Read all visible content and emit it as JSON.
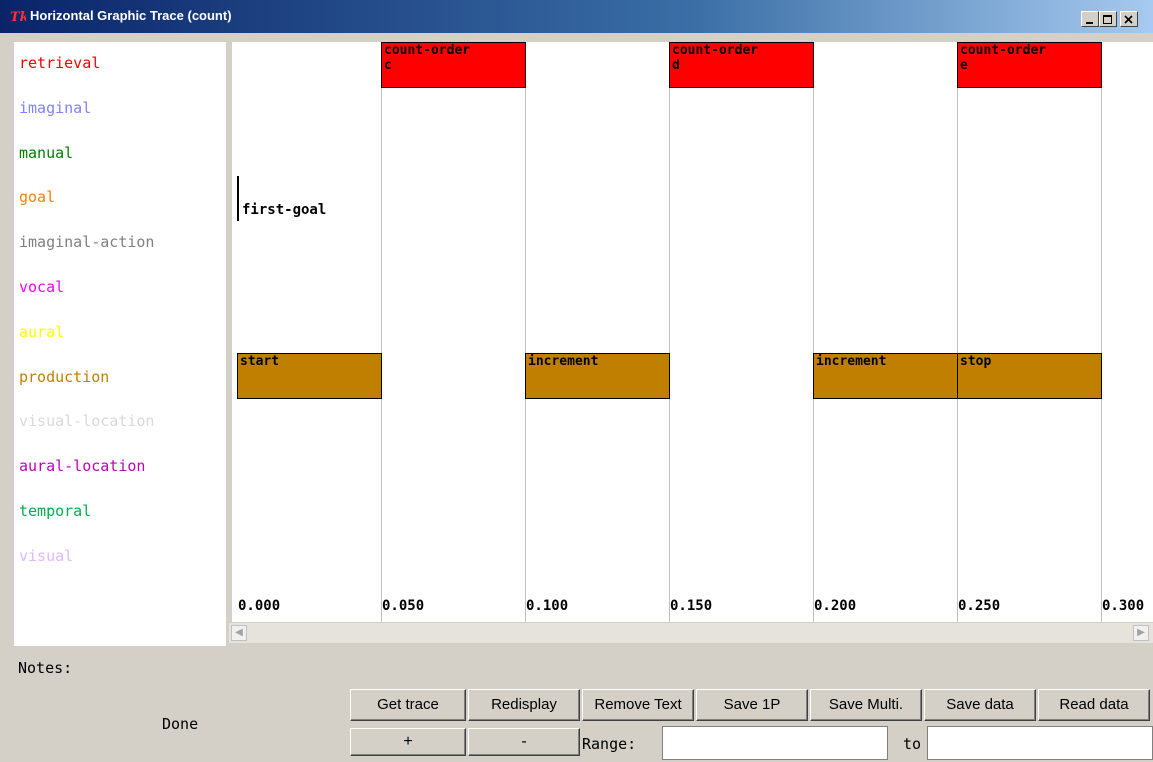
{
  "window": {
    "title": "Horizontal Graphic Trace (count)"
  },
  "modules": [
    {
      "label": "retrieval",
      "color": "#ff0000"
    },
    {
      "label": "imaginal",
      "color": "#8080ff"
    },
    {
      "label": "manual",
      "color": "#008000"
    },
    {
      "label": "goal",
      "color": "#ff8000"
    },
    {
      "label": "imaginal-action",
      "color": "#808080"
    },
    {
      "label": "vocal",
      "color": "#ff00ff"
    },
    {
      "label": "aural",
      "color": "#ffff00"
    },
    {
      "label": "production",
      "color": "#c07f00"
    },
    {
      "label": "visual-location",
      "color": "#d8d8d8"
    },
    {
      "label": "aural-location",
      "color": "#c000c0"
    },
    {
      "label": "temporal",
      "color": "#00b050"
    },
    {
      "label": "visual",
      "color": "#e0b8ff"
    }
  ],
  "trace": {
    "retrieval_boxes": [
      {
        "line1": "count-order",
        "line2": "c",
        "start": 0.05,
        "end": 0.1
      },
      {
        "line1": "count-order",
        "line2": "d",
        "start": 0.15,
        "end": 0.2
      },
      {
        "line1": "count-order",
        "line2": "e",
        "start": 0.25,
        "end": 0.3
      }
    ],
    "goal_event": {
      "label": "first-goal",
      "time": 0.0
    },
    "production_boxes": [
      {
        "label": "start",
        "start": 0.0,
        "end": 0.05
      },
      {
        "label": "increment",
        "start": 0.1,
        "end": 0.15
      },
      {
        "label": "increment",
        "start": 0.2,
        "end": 0.25
      },
      {
        "label": "stop",
        "start": 0.25,
        "end": 0.3
      }
    ],
    "ticks": [
      "0.000",
      "0.050",
      "0.100",
      "0.150",
      "0.200",
      "0.250",
      "0.300"
    ]
  },
  "notes_label": "Notes:",
  "status": "Done",
  "buttons": {
    "get_trace": "Get trace",
    "redisplay": "Redisplay",
    "remove_text": "Remove Text",
    "save_1p": "Save 1P",
    "save_multi": "Save Multi.",
    "save_data": "Save data",
    "read_data": "Read data",
    "plus": "+",
    "minus": "-"
  },
  "range": {
    "label": "Range:",
    "to": "to",
    "from_value": "",
    "to_value": ""
  }
}
